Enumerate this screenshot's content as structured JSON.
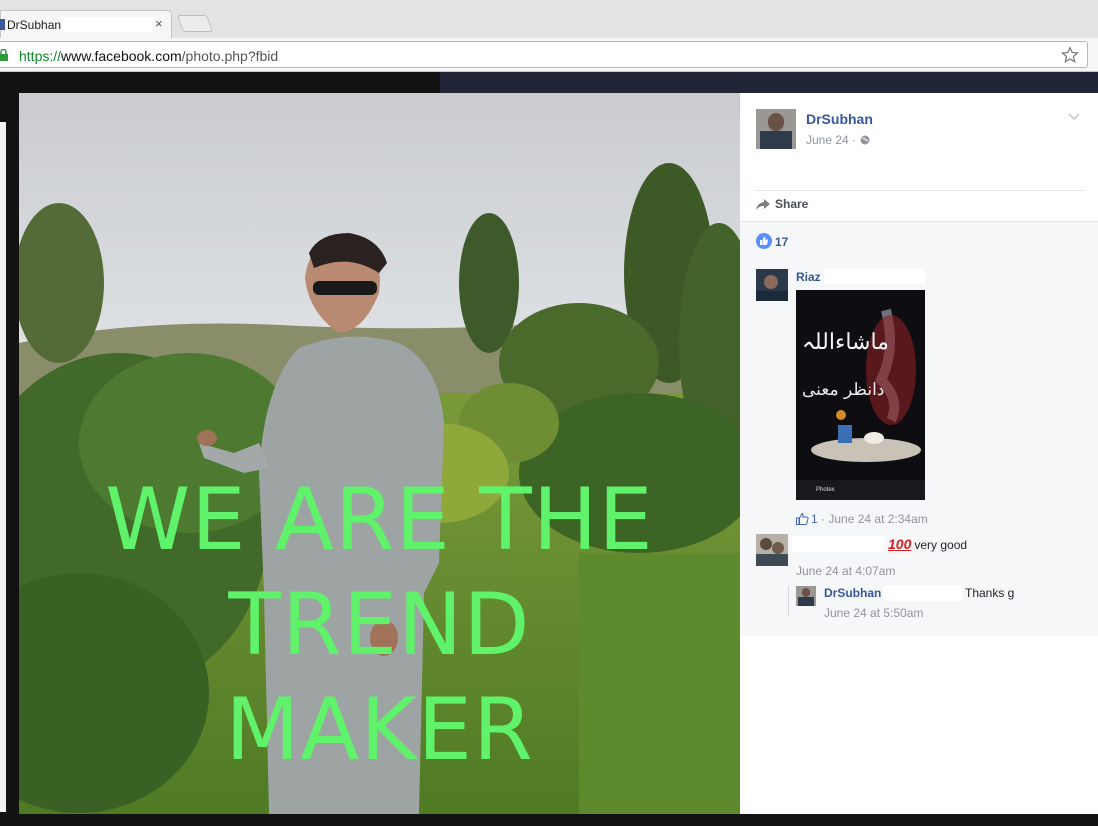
{
  "browser": {
    "tab_title": "DrSubhan",
    "tab_close": "×",
    "url_scheme": "https://",
    "url_host": "www.facebook.com",
    "url_path": "/photo.php?fbid"
  },
  "photo": {
    "caption_lines": [
      "WE ARE THE",
      "TREND",
      "MAKER"
    ],
    "caption_color": "#5ff26a"
  },
  "post": {
    "author": "DrSubhan",
    "date": "June 24 ·",
    "share_label": "Share",
    "like_count": "17"
  },
  "comments": [
    {
      "author": "Riaz",
      "attachment_label": "Photex",
      "attachment_text_1": "ماشاءاللہ",
      "attachment_text_2": "دانظر معنی",
      "likes": "1",
      "meta": " · June 24 at 2:34am"
    },
    {
      "author": "",
      "emoji": "100",
      "text": "very good",
      "meta": "June 24 at 4:07am"
    },
    {
      "author": "DrSubhan",
      "text": "Thanks g",
      "meta": "June 24 at 5:50am"
    }
  ],
  "colors": {
    "link": "#365899",
    "meta": "#90949c",
    "caption": "#5ff26a"
  }
}
